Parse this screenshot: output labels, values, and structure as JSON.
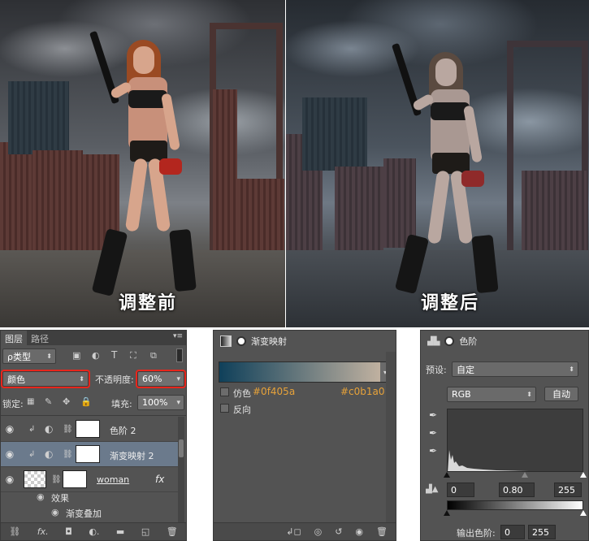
{
  "images": {
    "before_caption": "调整前",
    "after_caption": "调整后"
  },
  "layers_panel": {
    "tabs": [
      "图层",
      "路径"
    ],
    "filter_kind": "ρ类型",
    "filter_icons": [
      "image-filter-icon",
      "adjustment-filter-icon",
      "text-filter-icon",
      "shape-filter-icon",
      "smart-object-filter-icon"
    ],
    "blend_mode": "颜色",
    "opacity_label": "不透明度:",
    "opacity_value": "60%",
    "lock_label": "锁定:",
    "fill_label": "填充:",
    "fill_value": "100%",
    "layers": [
      {
        "name": "色阶 2",
        "selected": false
      },
      {
        "name": "渐变映射 2",
        "selected": true
      },
      {
        "name": "woman",
        "selected": false
      }
    ],
    "effects_label": "效果",
    "effect_item": "渐变叠加",
    "fx_label": "fx"
  },
  "gradient_map_panel": {
    "title": "渐变映射",
    "gradient_start": "#0f405a",
    "gradient_end": "#c0b1a0",
    "dither_label": "仿色",
    "dither_hex_start": "#0f405a",
    "dither_hex_end": "#c0b1a0",
    "reverse_label": "反向"
  },
  "levels_panel": {
    "title": "色阶",
    "preset_label": "预设:",
    "preset_value": "自定",
    "channel": "RGB",
    "auto_button": "自动",
    "input_black": "0",
    "input_gamma": "0.80",
    "input_white": "255",
    "output_label": "输出色阶:",
    "output_black": "0",
    "output_white": "255"
  }
}
